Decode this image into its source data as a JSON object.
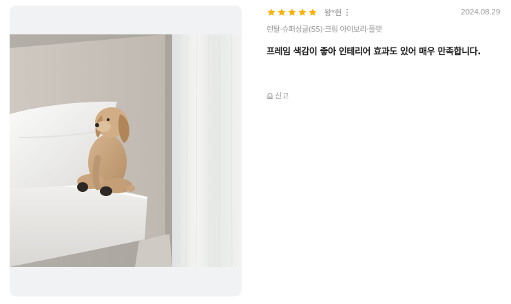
{
  "review": {
    "rating": 5,
    "star_color": "#FFB100",
    "author": "왕*현",
    "more_icon": "more-vertical-icon",
    "date": "2024.08.29",
    "option": "렌탈·슈퍼싱글(SS)·크림 아이보리·플랫",
    "text": "프레임 색감이 좋아 인테리어 효과도 있어 매우 만족합니다.",
    "report_icon": "siren-icon",
    "report_label": "신고"
  }
}
